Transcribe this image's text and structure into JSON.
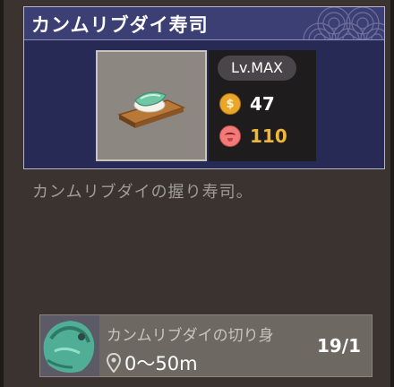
{
  "recipe": {
    "title": "カンムリブダイ寿司",
    "level": "Lv.MAX",
    "price": "47",
    "taste": "110",
    "description": "カンムリブダイの握り寿司。"
  },
  "ingredient": {
    "name": "カンムリブダイの切り身",
    "range": "0～50m",
    "count": "19/1"
  },
  "icons": {
    "coin": "coin-icon",
    "taste": "taste-face-icon",
    "location": "location-pin-icon"
  },
  "colors": {
    "price": "#ffffff",
    "taste": "#f0b63a",
    "card_bg": "#272a55"
  }
}
